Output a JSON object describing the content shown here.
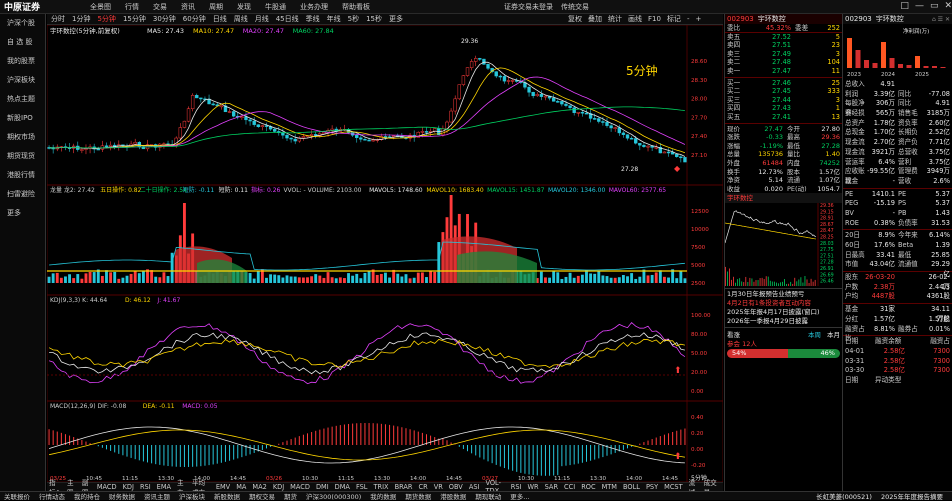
{
  "topbar": {
    "logo": "中原证券",
    "menu": [
      "全景图",
      "行情",
      "交易",
      "资讯",
      "周期",
      "发现",
      "牛股通",
      "业务办理",
      "帮助看板"
    ],
    "right": [
      "证券交易未登录",
      "传统交易"
    ],
    "btns": [
      "□",
      "—",
      "▭",
      "✕"
    ]
  },
  "sidebar": [
    "沪深个股",
    "自 选 股",
    "我的股票",
    "沪深板块",
    "热点主题",
    "新股IPO",
    "期权市场",
    "期货现货",
    "港股行情",
    "扫雷避险",
    "更多"
  ],
  "periods": {
    "items": [
      "分时",
      "1分钟",
      "5分钟",
      "15分钟",
      "30分钟",
      "60分钟",
      "日线",
      "周线",
      "月线",
      "45日线",
      "季线",
      "年线",
      "5秒",
      "15秒",
      "更多"
    ],
    "selected": "5分钟",
    "tools": [
      "复权",
      "叠加",
      "统计",
      "画线",
      "F10",
      "标记",
      "-",
      "+"
    ]
  },
  "chart": {
    "title": "宇环数控(5分钟,前复权)",
    "ma_labels": [
      {
        "t": "MA5: 27.43",
        "c": "#e8e8e8"
      },
      {
        "t": "MA10: 27.47",
        "c": "#ffd600"
      },
      {
        "t": "MA20: 27.47",
        "c": "#e040fb"
      },
      {
        "t": "MA60: 27.84",
        "c": "#00d060"
      }
    ],
    "period_text": "5分钟",
    "peak_label": "29.36",
    "low_label": "27.28",
    "price_axis": [
      "28.60",
      "28.30",
      "28.00",
      "27.70",
      "27.40",
      "27.10"
    ],
    "vol_header": [
      {
        "t": "龙量  龙2: 27.42",
        "c": "#ccc"
      },
      {
        "t": "五日操作: 0.82",
        "c": "#ffd600"
      },
      {
        "t": "二十日操作: 2.54",
        "c": "#00d060"
      },
      {
        "t": "短防: -0.11",
        "c": "#26c6da"
      },
      {
        "t": "短防: 0.11",
        "c": "#e8e8e8"
      },
      {
        "t": "指标: 0.26",
        "c": "#e040fb"
      },
      {
        "t": "VVOL: - VOLUME: 2103.00",
        "c": "#ccc"
      },
      {
        "t": "MAVOL5: 1748.60",
        "c": "#e8e8e8"
      },
      {
        "t": "MAVOL10: 1683.40",
        "c": "#ffd600"
      },
      {
        "t": "MAVOL15: 1451.87",
        "c": "#00d060"
      },
      {
        "t": "MAVOL20: 1346.00",
        "c": "#26c6da"
      },
      {
        "t": "MAVOL60: 2577.65",
        "c": "#e040fb"
      }
    ],
    "vol_axis": [
      "12500",
      "10000",
      "7500",
      "5000",
      "2500"
    ],
    "kdj_header": [
      {
        "t": "KDJ(9,3,3)  K: 44.64",
        "c": "#ccc"
      },
      {
        "t": "D: 46.12",
        "c": "#ffd600"
      },
      {
        "t": "J: 41.67",
        "c": "#e040fb"
      }
    ],
    "kdj_axis": [
      "100.00",
      "80.00",
      "50.00",
      "20.00",
      "0.00"
    ],
    "macd_header": [
      {
        "t": "MACD(12,26,9)  DIF: -0.08",
        "c": "#ccc"
      },
      {
        "t": "DEA: -0.11",
        "c": "#ffd600"
      },
      {
        "t": "MACD: 0.05",
        "c": "#e040fb"
      }
    ],
    "macd_axis": [
      "0.40",
      "0.20",
      "0.00",
      "-0.20"
    ],
    "time_axis": [
      "03/25",
      "10:45",
      "11:15",
      "13:30",
      "14:00",
      "14:45",
      "03/26",
      "10:30",
      "11:15",
      "13:30",
      "14:00",
      "14:45",
      "03/27",
      "10:30",
      "11:15",
      "13:30",
      "14:00",
      "14:45"
    ],
    "badge": "5分钟"
  },
  "indicators": {
    "items": [
      "指标A",
      "主图",
      "副图",
      "MACD",
      "KDJ",
      "RSI",
      "EMA",
      "主力",
      "平均成本",
      "EMV",
      "MA",
      "MA2",
      "KDJ",
      "MACD",
      "DMI",
      "DMA",
      "FSL",
      "TRIX",
      "BRAR",
      "CR",
      "VR",
      "OBV",
      "ASI",
      "VOL-TDX",
      "RSI",
      "WR",
      "SAR",
      "CCI",
      "ROC",
      "MTM",
      "BOLL",
      "PSY",
      "MCST",
      "流域",
      "成交量"
    ],
    "selected": "MACD"
  },
  "quote": {
    "code": "002903",
    "name": "宇环数控",
    "webi": "45.32%",
    "weicha": "252",
    "asks": [
      {
        "l": "卖五",
        "p": "27.52",
        "v": "5"
      },
      {
        "l": "卖四",
        "p": "27.51",
        "v": "23"
      },
      {
        "l": "卖三",
        "p": "27.49",
        "v": "3"
      },
      {
        "l": "卖二",
        "p": "27.48",
        "v": "104"
      },
      {
        "l": "卖一",
        "p": "27.47",
        "v": "11"
      }
    ],
    "bids": [
      {
        "l": "买一",
        "p": "27.46",
        "v": "25"
      },
      {
        "l": "买二",
        "p": "27.45",
        "v": "333"
      },
      {
        "l": "买三",
        "p": "27.44",
        "v": "3"
      },
      {
        "l": "买四",
        "p": "27.43",
        "v": "1"
      },
      {
        "l": "买五",
        "p": "27.41",
        "v": "13"
      }
    ],
    "stats": [
      [
        "现价",
        "27.47",
        "今开",
        "27.80"
      ],
      [
        "涨跌",
        "-0.33",
        "最高",
        "29.36"
      ],
      [
        "涨幅",
        "-1.19%",
        "最低",
        "27.28"
      ],
      [
        "总量",
        "135736",
        "量比",
        "1.40"
      ],
      [
        "外盘",
        "61484",
        "内盘",
        "74252"
      ],
      [
        "换手",
        "12.73%",
        "股本",
        "1.57亿"
      ],
      [
        "净资",
        "5.14",
        "流通",
        "1.07亿"
      ],
      [
        "收益",
        "0.020",
        "PE(动)",
        "1054.7"
      ]
    ],
    "mini_title": "宇环数控",
    "mini_axis": [
      "29.36",
      "29.15",
      "28.91",
      "28.67",
      "28.47",
      "28.25",
      "28.03",
      "27.75",
      "27.51",
      "27.28",
      "26.91",
      "26.69",
      "26.46"
    ],
    "news_title": "1月30日年报预告业绩预亏",
    "news": [
      "4月2日有1条投资者互动内容",
      "2025年年报4月17日披露(窗口)",
      "2026年一季报4月29日披露"
    ],
    "sentiment": {
      "label": "看涨",
      "votes": "参会 12人",
      "bull": "54%",
      "bear": "46%",
      "today": "本周",
      "last": "本月"
    }
  },
  "fin": {
    "code": "002903",
    "name": "宇环数控",
    "chart_label": "净利润(万)",
    "years": [
      "2023",
      "2024",
      "2025"
    ],
    "rows": [
      [
        "总收入",
        "4.91"
      ],
      [
        "利润",
        "3.39亿",
        "同比",
        "-77.08"
      ],
      [
        "每股净资",
        "306万",
        "同比",
        "4.91"
      ],
      [
        "非经损",
        "565万",
        "销售毛",
        "3185万"
      ],
      [
        "总资产",
        "1.78亿",
        "资负率",
        "2.60亿"
      ],
      [
        "总现金",
        "1.70亿",
        "长期负",
        "2.52亿"
      ],
      [
        "现金流",
        "2.70亿",
        "资产负",
        "7.71亿"
      ],
      [
        "现金流",
        "3921万",
        "总营收",
        "3.75亿"
      ],
      [
        "营运率",
        "6.4%",
        "营利",
        "3.75亿"
      ],
      [
        "应收账款",
        "-99.55亿",
        "管理费",
        "3949万"
      ],
      [
        "现金",
        "-",
        "营收",
        "2.6%"
      ]
    ],
    "val": [
      [
        "PE",
        "1410.1",
        "PE",
        "5.37"
      ],
      [
        "PEG",
        "-15.19",
        "PS",
        "5.37"
      ],
      [
        "BV",
        "-",
        "PB",
        "1.43"
      ],
      [
        "ROE",
        "0.38%",
        "负债率",
        "31.53"
      ]
    ],
    "rank": [
      [
        "20日",
        "8.9%",
        "今年来",
        "6.14%"
      ],
      [
        "60日",
        "17.6%",
        "Beta",
        "1.39"
      ],
      [
        "日最高",
        "33.41",
        "最低",
        "25.85"
      ],
      [
        "市值",
        "43.04亿",
        "流通值",
        "29.29亿"
      ]
    ],
    "events": [
      [
        "股东",
        "26-03-20",
        "",
        "26-02-13"
      ],
      [
        "户数",
        "2.38万",
        "",
        "2.44万"
      ],
      [
        "户均",
        "4487股",
        "",
        "4361股"
      ]
    ],
    "inst": [
      [
        "基金",
        "31家",
        "",
        "34.11万股"
      ],
      [
        "分红",
        "1.57亿",
        "",
        "1.57亿"
      ],
      [
        "融资占比",
        "8.81%",
        "融券占",
        "0.01%"
      ]
    ],
    "margin": {
      "head": [
        "日期",
        "融资余额",
        "融资占"
      ],
      "rows": [
        [
          "04-01",
          "2.58亿",
          "7300"
        ],
        [
          "03-31",
          "2.58亿",
          "7300"
        ],
        [
          "03-30",
          "2.58亿",
          "7300"
        ]
      ]
    },
    "footer": [
      "日期",
      "异动类型"
    ]
  },
  "statusbar": [
    "关联报价",
    "行情动态",
    "我的持仓",
    "财务数据",
    "资讯主题",
    "沪深板块",
    "新股数据",
    "期权交易",
    "期货",
    "沪深300(000300)",
    "我的数据",
    "期货数据",
    "港股数据",
    "期现联动",
    "更多..."
  ],
  "statusbar_right": [
    "长虹美菱(000521)",
    "2025年年度报告摘要"
  ]
}
